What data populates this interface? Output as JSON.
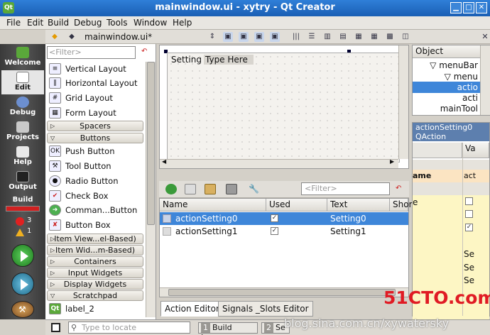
{
  "window": {
    "title": "mainwindow.ui - xytry - Qt Creator"
  },
  "menubar": {
    "items": [
      "File",
      "Edit",
      "Build",
      "Debug",
      "Tools",
      "Window",
      "Help"
    ]
  },
  "editor_toolbar": {
    "current_file": "mainwindow.ui*"
  },
  "mode_sidebar": {
    "modes": [
      "Welcome",
      "Edit",
      "Debug",
      "Projects",
      "Help",
      "Output"
    ],
    "selected": "Edit",
    "build_label": "Build",
    "error_count": "3",
    "warning_count": "1"
  },
  "widget_box": {
    "filter_placeholder": "<Filter>",
    "items": [
      {
        "label": "Vertical Layout",
        "icon": "vertical-layout-icon"
      },
      {
        "label": "Horizontal Layout",
        "icon": "horizontal-layout-icon"
      },
      {
        "label": "Grid Layout",
        "icon": "grid-layout-icon"
      },
      {
        "label": "Form Layout",
        "icon": "form-layout-icon"
      }
    ],
    "cat_spacers": "Spacers",
    "cat_buttons": "Buttons",
    "buttons": [
      {
        "label": "Push Button",
        "icon": "push-button-icon"
      },
      {
        "label": "Tool Button",
        "icon": "tool-button-icon"
      },
      {
        "label": "Radio Button",
        "icon": "radio-button-icon"
      },
      {
        "label": "Check Box",
        "icon": "check-box-icon"
      },
      {
        "label": "Comman...Button",
        "icon": "command-link-icon"
      },
      {
        "label": "Button Box",
        "icon": "button-box-icon"
      }
    ],
    "cat_item_views": "Item View...el-Based)",
    "cat_item_widgets": "Item Wid...m-Based)",
    "cat_containers": "Containers",
    "cat_input_widgets": "Input Widgets",
    "cat_display_widgets": "Display Widgets",
    "cat_scratchpad": "Scratchpad",
    "scratchpad_item": "label_2"
  },
  "form": {
    "menu_items": [
      "Setting",
      "Type Here"
    ]
  },
  "action_editor": {
    "filter_placeholder": "<Filter>",
    "columns": [
      "Name",
      "Used",
      "Text",
      "Shor"
    ],
    "rows": [
      {
        "name": "actionSetting0",
        "used": true,
        "text": "Setting0"
      },
      {
        "name": "actionSetting1",
        "used": true,
        "text": "Setting1"
      }
    ]
  },
  "bottom_tabs": [
    "Action Editor",
    "Signals _Slots Editor"
  ],
  "object_inspector": {
    "header": "Object",
    "rows": [
      "menuBar",
      "menu",
      "actio",
      "acti",
      "mainTool"
    ]
  },
  "property_editor": {
    "object_name": "actionSetting0",
    "class_name": "QAction",
    "value_header": "Va",
    "name_header": "ame",
    "name_header_value": "act",
    "row_e": "e",
    "values_se": [
      "Se",
      "Se",
      "Se"
    ]
  },
  "status_bar": {
    "locate_placeholder": "Type to locate",
    "panes": [
      {
        "num": "1",
        "label": "Build Issues"
      },
      {
        "num": "2",
        "label": "Se"
      }
    ]
  },
  "watermark": "blog.sina.com.cn/xywatersky",
  "logo_text": "51CTO.com"
}
